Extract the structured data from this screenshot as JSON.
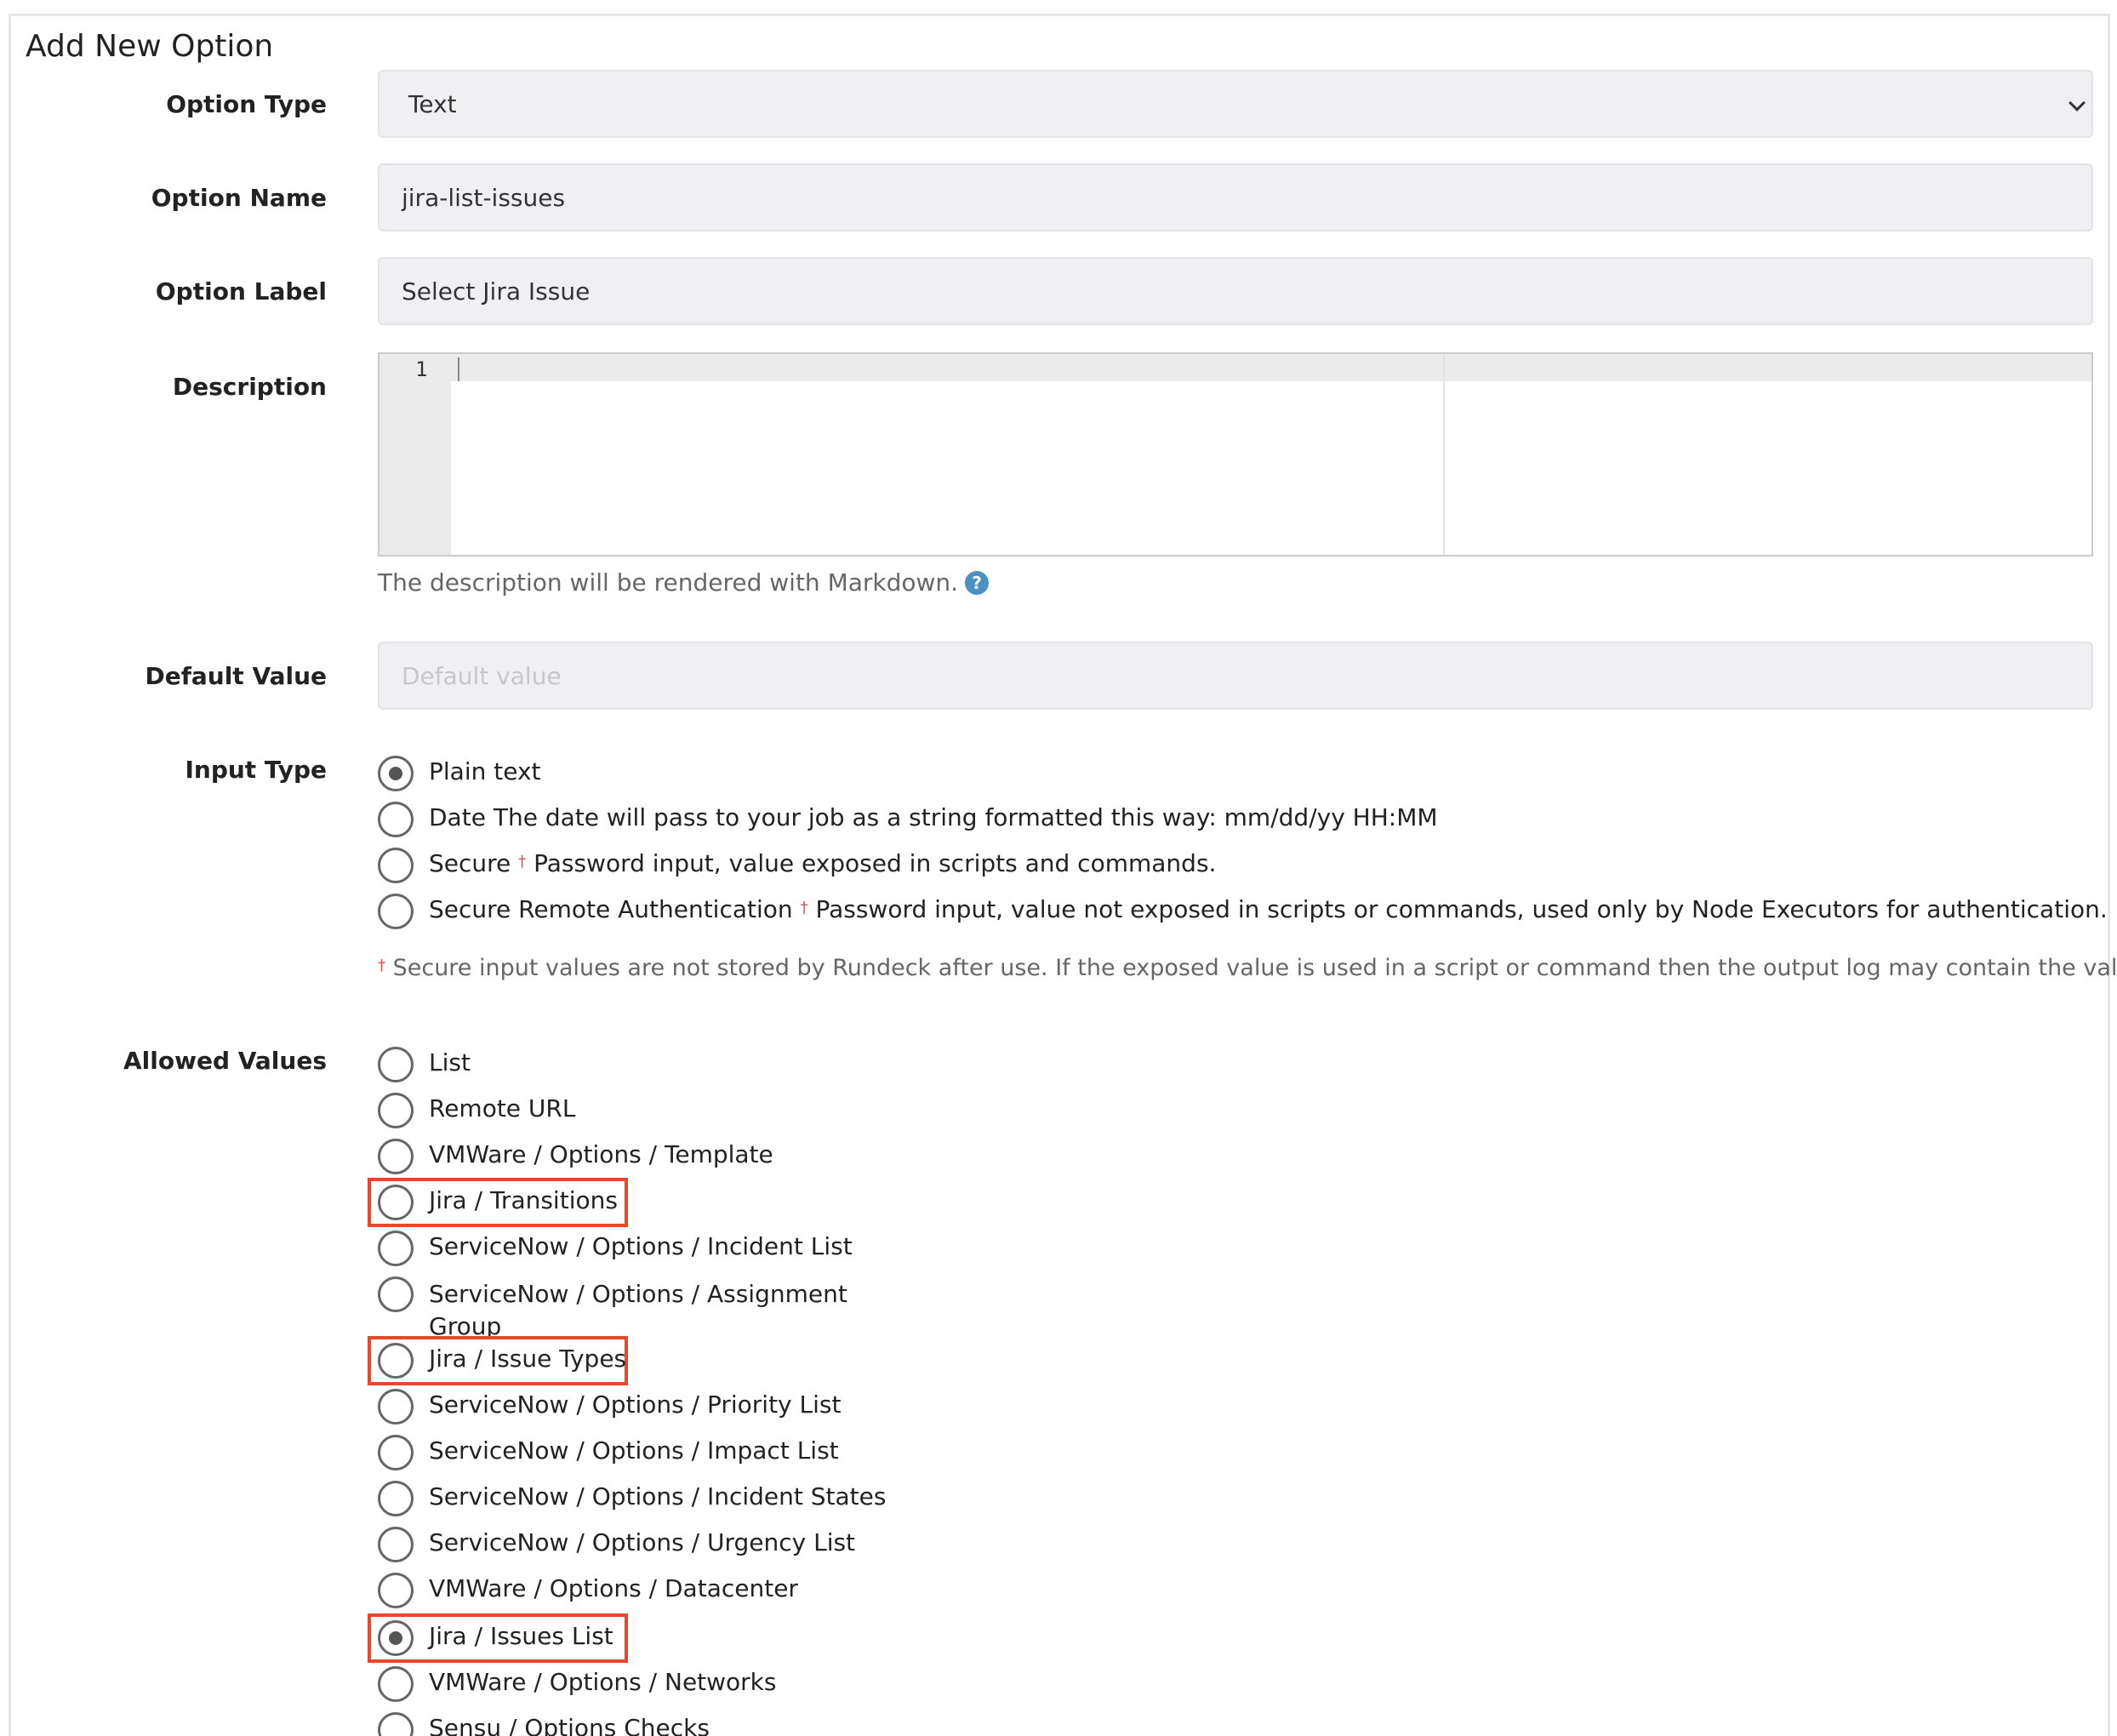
{
  "page": {
    "title": "Add New Option"
  },
  "form": {
    "option_type": {
      "label": "Option Type",
      "value": "Text"
    },
    "option_name": {
      "label": "Option Name",
      "value": "jira-list-issues"
    },
    "option_label": {
      "label": "Option Label",
      "value": "Select Jira Issue"
    },
    "description": {
      "label": "Description",
      "line_number": "1",
      "help": "The description will be rendered with Markdown."
    },
    "default_value": {
      "label": "Default Value",
      "placeholder": "Default value"
    },
    "input_type": {
      "label": "Input Type",
      "options": [
        {
          "name": "Plain text",
          "desc": "",
          "checked": true
        },
        {
          "name": "Date",
          "desc": "The date will pass to your job as a string formatted this way: mm/dd/yy HH:MM",
          "checked": false
        },
        {
          "name": "Secure",
          "desc": "Password input, value exposed in scripts and commands.",
          "checked": false
        },
        {
          "name": "Secure Remote Authentication",
          "desc": "Password input, value not exposed in scripts or commands, used only by Node Executors for authentication.",
          "checked": false
        }
      ],
      "dagger": "†",
      "note": "Secure input values are not stored by Rundeck after use. If the exposed value is used in a script or command then the output log may contain the value."
    },
    "allowed_values": {
      "label": "Allowed Values",
      "options": [
        {
          "name": "List",
          "checked": false
        },
        {
          "name": "Remote URL",
          "checked": false
        },
        {
          "name": "VMWare / Options / Template",
          "checked": false
        },
        {
          "name": "Jira / Transitions",
          "checked": false,
          "highlighted": true
        },
        {
          "name": "ServiceNow / Options / Incident List",
          "checked": false
        },
        {
          "name": "ServiceNow / Options / Assignment Group",
          "checked": false
        },
        {
          "name": "Jira / Issue Types",
          "checked": false,
          "highlighted": true
        },
        {
          "name": "ServiceNow / Options / Priority List",
          "checked": false
        },
        {
          "name": "ServiceNow / Options / Impact List",
          "checked": false
        },
        {
          "name": "ServiceNow / Options / Incident States",
          "checked": false
        },
        {
          "name": "ServiceNow / Options / Urgency List",
          "checked": false
        },
        {
          "name": "VMWare / Options / Datacenter",
          "checked": false
        },
        {
          "name": "Jira / Issues List",
          "checked": true,
          "highlighted": true
        },
        {
          "name": "VMWare / Options / Networks",
          "checked": false
        },
        {
          "name": "Sensu / Options Checks",
          "checked": false
        }
      ]
    }
  },
  "colors": {
    "highlight": "#e34a2a",
    "help_icon": "#4a90c2",
    "dagger": "#d9534f"
  }
}
